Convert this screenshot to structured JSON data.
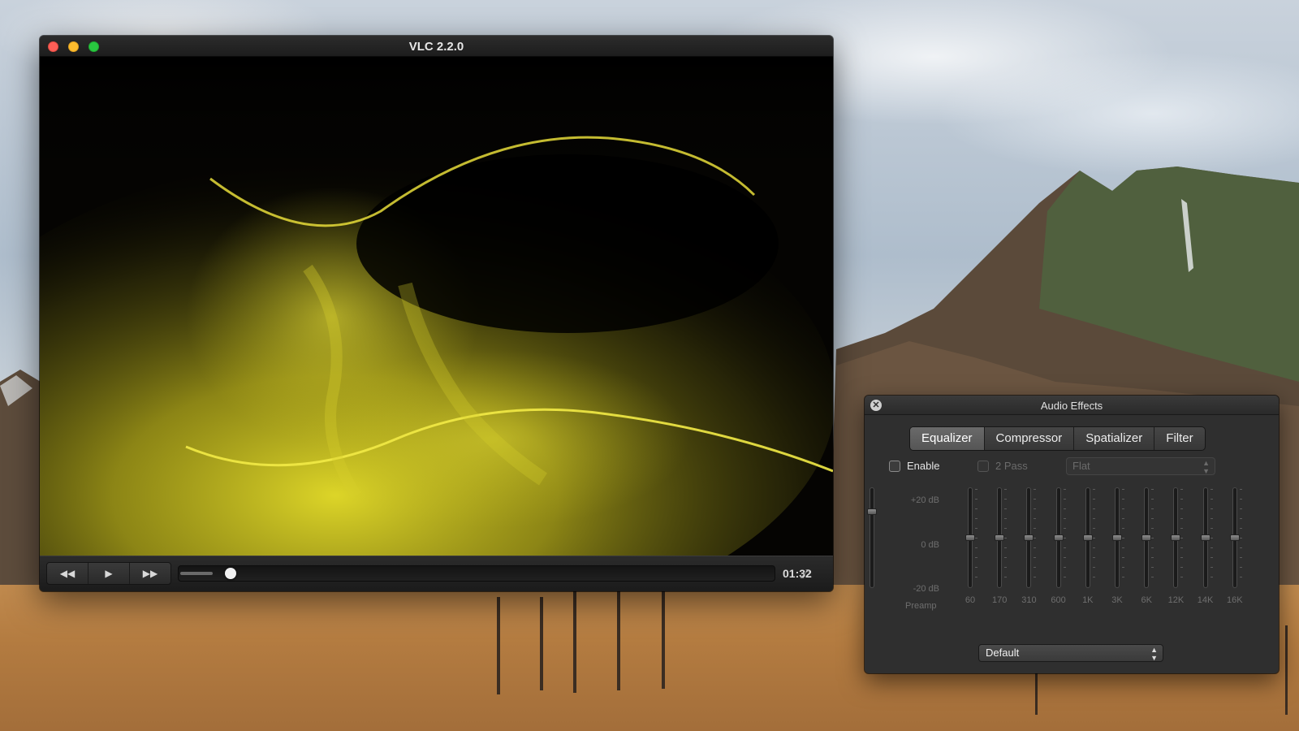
{
  "vlc": {
    "title": "VLC 2.2.0",
    "controls": {
      "rewind_icon": "rewind-icon",
      "play_icon": "play-icon",
      "fast_forward_icon": "fast-forward-icon",
      "time": "01:32",
      "playback_position_fraction": 0.06,
      "fullscreen_icon": "fullscreen-icon"
    }
  },
  "audio_effects": {
    "title": "Audio Effects",
    "tabs": [
      {
        "label": "Equalizer",
        "active": true
      },
      {
        "label": "Compressor",
        "active": false
      },
      {
        "label": "Spatializer",
        "active": false
      },
      {
        "label": "Filter",
        "active": false
      }
    ],
    "enable_label": "Enable",
    "two_pass_label": "2 Pass",
    "preset_value": "Flat",
    "db_labels": {
      "top": "+20 dB",
      "mid": "0 dB",
      "bottom": "-20 dB"
    },
    "preamp_label": "Preamp",
    "preamp_level_fraction": 0.78,
    "bands": [
      {
        "label": "60",
        "level_fraction": 0.5
      },
      {
        "label": "170",
        "level_fraction": 0.5
      },
      {
        "label": "310",
        "level_fraction": 0.5
      },
      {
        "label": "600",
        "level_fraction": 0.5
      },
      {
        "label": "1K",
        "level_fraction": 0.5
      },
      {
        "label": "3K",
        "level_fraction": 0.5
      },
      {
        "label": "6K",
        "level_fraction": 0.5
      },
      {
        "label": "12K",
        "level_fraction": 0.5
      },
      {
        "label": "14K",
        "level_fraction": 0.5
      },
      {
        "label": "16K",
        "level_fraction": 0.5
      }
    ],
    "profile_value": "Default"
  },
  "colors": {
    "traffic_close": "#fc5f57",
    "traffic_minimize": "#fdbc2e",
    "traffic_maximize": "#29c840",
    "visualizer_yellow": "#d9d21a"
  }
}
